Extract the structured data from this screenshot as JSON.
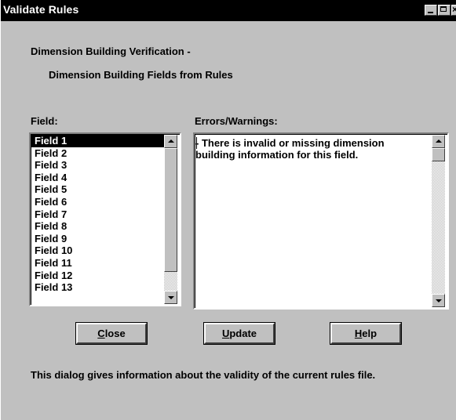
{
  "window": {
    "title": "Validate Rules"
  },
  "heading": {
    "line1": "Dimension Building Verification -",
    "line2": "Dimension Building Fields from Rules"
  },
  "field_panel": {
    "label": "Field:",
    "items": [
      "Field 1",
      "Field 2",
      "Field 3",
      "Field 4",
      "Field 5",
      "Field 6",
      "Field 7",
      "Field 8",
      "Field 9",
      "Field 10",
      "Field 11",
      "Field 12",
      "Field 13"
    ],
    "selected": "Field 1"
  },
  "errors_panel": {
    "label": "Errors/Warnings:",
    "text": "- There is invalid or missing dimension building information for this field."
  },
  "buttons": {
    "close": {
      "accel": "C",
      "rest": "lose"
    },
    "update": {
      "accel": "U",
      "rest": "pdate"
    },
    "help": {
      "accel": "H",
      "rest": "elp"
    }
  },
  "footer": "This dialog gives information about the validity of the current rules file."
}
